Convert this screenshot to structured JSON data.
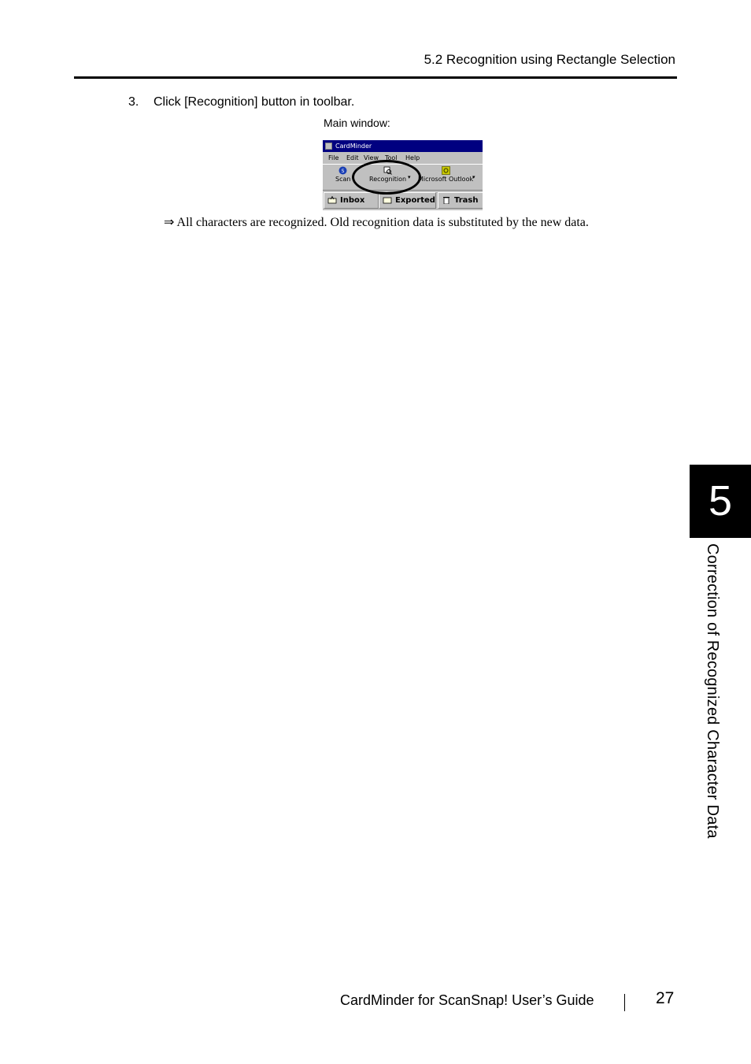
{
  "header": {
    "section": "5.2 Recognition using Rectangle Selection"
  },
  "step": {
    "number": "3.",
    "text": "Click [Recognition] button in toolbar."
  },
  "figure": {
    "caption": "Main window:",
    "window_title": "CardMinder",
    "menu": [
      "File",
      "Edit",
      "View",
      "Tool",
      "Help"
    ],
    "toolbar": {
      "scan": "Scan",
      "recognition": "Recognition",
      "outlook": "Microsoft Outlook"
    },
    "tabs": [
      "Inbox",
      "Exported",
      "Trash"
    ]
  },
  "result": "⇒ All characters are recognized. Old recognition data is substituted by the new data.",
  "side_tab": {
    "chapter": "5",
    "title": "Correction of Recognized Character Data"
  },
  "footer": {
    "guide": "CardMinder for ScanSnap! User’s Guide",
    "page": "27"
  }
}
